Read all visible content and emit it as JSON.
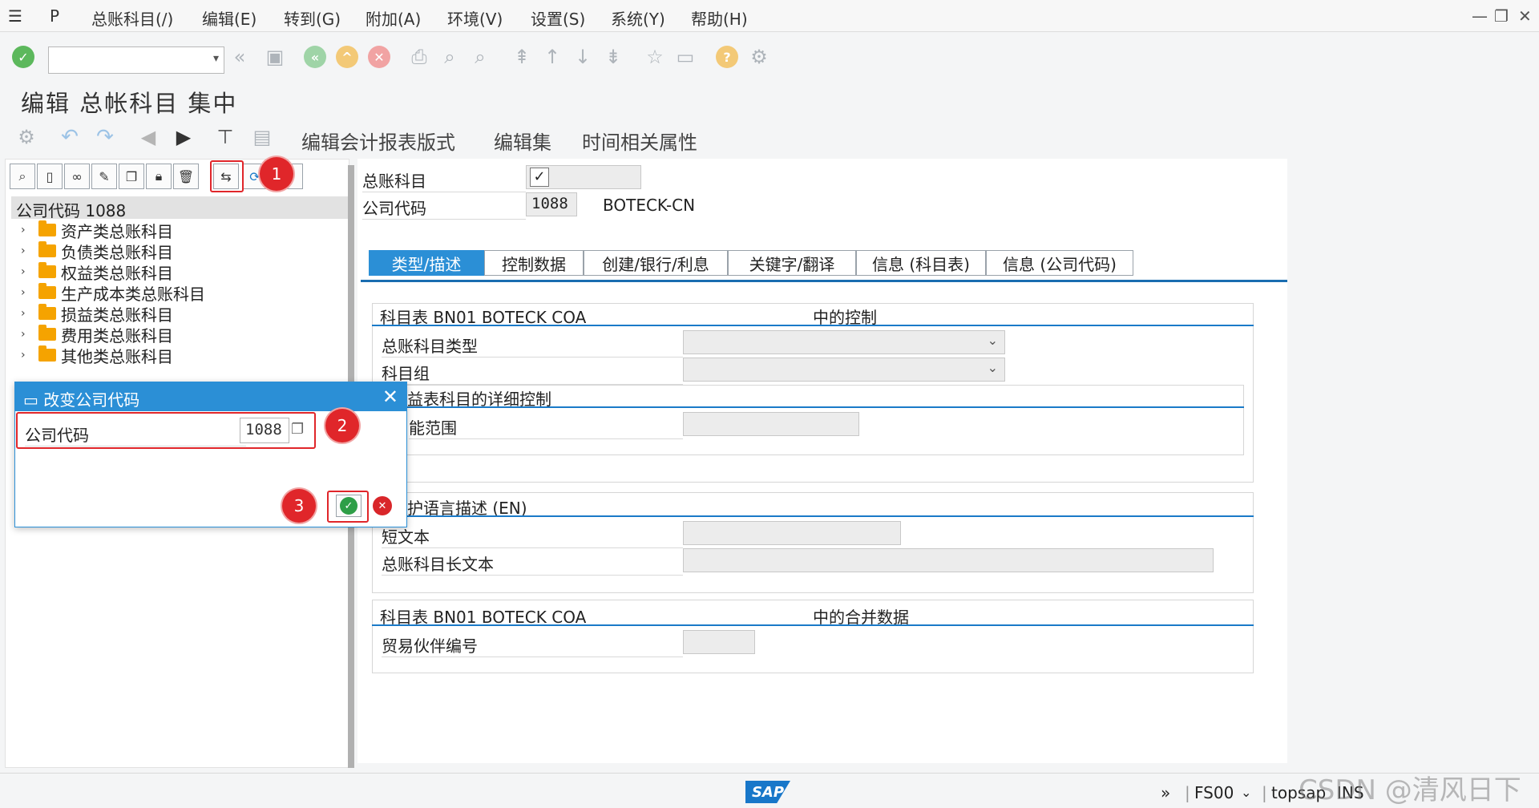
{
  "menu": {
    "items": [
      "总账科目(/)",
      "编辑(E)",
      "转到(G)",
      "附加(A)",
      "环境(V)",
      "设置(S)",
      "系统(Y)",
      "帮助(H)"
    ]
  },
  "title": "编辑 总帐科目 集中",
  "app_toolbar": {
    "buttons": [
      "编辑会计报表版式",
      "编辑集",
      "时间相关属性"
    ]
  },
  "tree": {
    "root": "公司代码 1088",
    "items": [
      "资产类总账科目",
      "负债类总账科目",
      "权益类总账科目",
      "生产成本类总账科目",
      "损益类总账科目",
      "费用类总账科目",
      "其他类总账科目"
    ]
  },
  "header": {
    "gl_account_label": "总账科目",
    "company_code_label": "公司代码",
    "company_code_value": "1088",
    "company_name": "BOTECK-CN"
  },
  "tabs": [
    "类型/描述",
    "控制数据",
    "创建/银行/利息",
    "关键字/翻译",
    "信息 (科目表)",
    "信息 (公司代码)"
  ],
  "section1": {
    "title_left": "科目表 BN01 BOTECK COA",
    "title_right": "中的控制",
    "gl_type_label": "总账科目类型",
    "account_group_label": "科目组",
    "pl_detail_title": "益表科目的详细控制",
    "func_area_label": "能范围"
  },
  "section2": {
    "title": "护语言描述 (EN)",
    "short_text_label": "短文本",
    "long_text_label": "总账科目长文本"
  },
  "section3": {
    "title_left": "科目表 BN01 BOTECK COA",
    "title_right": "中的合并数据",
    "partner_label": "贸易伙伴编号"
  },
  "dialog": {
    "title": "改变公司代码",
    "field_label": "公司代码",
    "field_value": "1088"
  },
  "markers": [
    "1",
    "2",
    "3"
  ],
  "status": {
    "logo": "SAP",
    "tcode": "FS00",
    "server": "topsap",
    "mode": "INS"
  },
  "watermark": "CSDN @清风日下"
}
